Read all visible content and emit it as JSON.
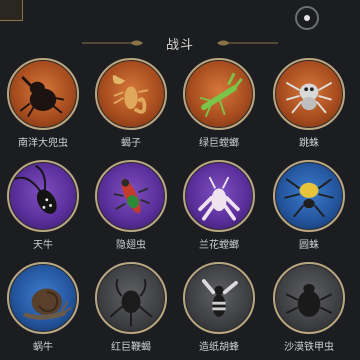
{
  "header": {
    "title": "战斗"
  },
  "insects": [
    {
      "label": "南洋大兜虫",
      "icon": "rhino-beetle-icon",
      "tier": "orange"
    },
    {
      "label": "蝎子",
      "icon": "scorpion-icon",
      "tier": "orange"
    },
    {
      "label": "绿巨螳螂",
      "icon": "mantis-icon",
      "tier": "orange"
    },
    {
      "label": "跳蛛",
      "icon": "jumping-spider-icon",
      "tier": "orange"
    },
    {
      "label": "天牛",
      "icon": "longhorn-beetle-icon",
      "tier": "purple"
    },
    {
      "label": "隐翅虫",
      "icon": "rove-beetle-icon",
      "tier": "purple"
    },
    {
      "label": "兰花螳螂",
      "icon": "orchid-mantis-icon",
      "tier": "purple"
    },
    {
      "label": "圆蛛",
      "icon": "orb-spider-icon",
      "tier": "blue"
    },
    {
      "label": "蜗牛",
      "icon": "snail-icon",
      "tier": "blue"
    },
    {
      "label": "红巨鞭蝎",
      "icon": "whip-scorpion-icon",
      "tier": "gray"
    },
    {
      "label": "造纸胡蜂",
      "icon": "paper-wasp-icon",
      "tier": "gray"
    },
    {
      "label": "沙漠铁甲虫",
      "icon": "desert-beetle-icon",
      "tier": "gray"
    }
  ],
  "colors": {
    "orange": "#c86a30",
    "purple": "#6a3fb0",
    "blue": "#2f6dbf",
    "gray": "#4a4b4e",
    "ring": "#b9a782",
    "text": "#cfd0d2"
  }
}
